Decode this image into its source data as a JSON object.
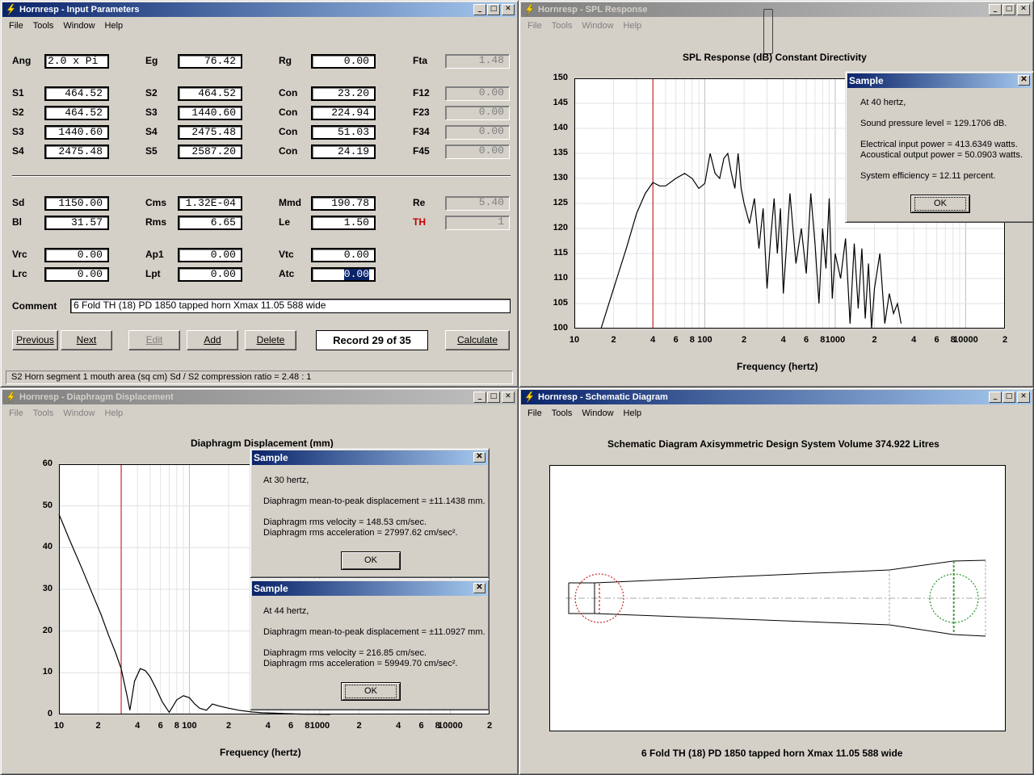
{
  "app_icon": "lightning-icon",
  "colors": {
    "active_title": "#0a246a",
    "marker": "#c00000",
    "mouth_circle": "#008000"
  },
  "input_win": {
    "title": "Hornresp - Input Parameters",
    "menu": [
      "File",
      "Tools",
      "Window",
      "Help"
    ],
    "rows": [
      [
        {
          "l": "Ang",
          "v": "2.0 x Pi"
        },
        {
          "l": "Eg",
          "v": "76.42"
        },
        {
          "l": "Rg",
          "v": "0.00"
        },
        {
          "l": "Fta",
          "v": "1.48"
        }
      ],
      [
        {
          "l": "S1",
          "v": "464.52"
        },
        {
          "l": "S2",
          "v": "464.52"
        },
        {
          "l": "Con",
          "v": "23.20"
        },
        {
          "l": "F12",
          "v": "0.00"
        }
      ],
      [
        {
          "l": "S2",
          "v": "464.52"
        },
        {
          "l": "S3",
          "v": "1440.60"
        },
        {
          "l": "Con",
          "v": "224.94"
        },
        {
          "l": "F23",
          "v": "0.00"
        }
      ],
      [
        {
          "l": "S3",
          "v": "1440.60"
        },
        {
          "l": "S4",
          "v": "2475.48"
        },
        {
          "l": "Con",
          "v": "51.03"
        },
        {
          "l": "F34",
          "v": "0.00"
        }
      ],
      [
        {
          "l": "S4",
          "v": "2475.48"
        },
        {
          "l": "S5",
          "v": "2587.20"
        },
        {
          "l": "Con",
          "v": "24.19"
        },
        {
          "l": "F45",
          "v": "0.00"
        }
      ],
      [
        {
          "l": "Sd",
          "v": "1150.00"
        },
        {
          "l": "Cms",
          "v": "1.32E-04"
        },
        {
          "l": "Mmd",
          "v": "190.78"
        },
        {
          "l": "Re",
          "v": "5.40"
        }
      ],
      [
        {
          "l": "Bl",
          "v": "31.57"
        },
        {
          "l": "Rms",
          "v": "6.65"
        },
        {
          "l": "Le",
          "v": "1.50"
        },
        {
          "l": "TH",
          "v": "1"
        }
      ],
      [
        {
          "l": "Vrc",
          "v": "0.00"
        },
        {
          "l": "Ap1",
          "v": "0.00"
        },
        {
          "l": "Vtc",
          "v": "0.00"
        }
      ],
      [
        {
          "l": "Lrc",
          "v": "0.00"
        },
        {
          "l": "Lpt",
          "v": "0.00"
        },
        {
          "l": "Atc",
          "v": "0.00"
        }
      ]
    ],
    "comment_label": "Comment",
    "comment": "6 Fold TH (18) PD 1850 tapped horn  Xmax 11.05 588 wide",
    "buttons": {
      "previous": "Previous",
      "next": "Next",
      "edit": "Edit",
      "add": "Add",
      "delete": "Delete",
      "calculate": "Calculate"
    },
    "record": "Record 29 of 35",
    "status": "S2   Horn segment 1 mouth area  (sq cm)   Sd / S2 compression ratio = 2.48 : 1"
  },
  "spl_win": {
    "title": "Hornresp - SPL Response",
    "menu": [
      "File",
      "Tools",
      "Window",
      "Help"
    ],
    "chart_title": "SPL Response (dB)   Constant Directivity",
    "xlabel": "Frequency (hertz)",
    "yticks": [
      "150",
      "145",
      "140",
      "135",
      "130",
      "125",
      "120",
      "115",
      "110",
      "105",
      "100"
    ],
    "xticks": [
      "10",
      "2",
      "4",
      "6",
      "8",
      "100",
      "2",
      "4",
      "6",
      "8",
      "1000",
      "2",
      "4",
      "6",
      "8",
      "10000",
      "2"
    ],
    "dialog": {
      "title": "Sample",
      "lines": [
        "At 40 hertz,",
        "Sound pressure level = 129.1706 dB.",
        "Electrical input power = 413.6349 watts.",
        "Acoustical output power = 50.0903 watts.",
        "System efficiency = 12.11 percent."
      ],
      "ok": "OK"
    }
  },
  "disp_win": {
    "title": "Hornresp - Diaphragm Displacement",
    "menu": [
      "File",
      "Tools",
      "Window",
      "Help"
    ],
    "chart_title": "Diaphragm Displacement (mm)",
    "xlabel": "Frequency (hertz)",
    "yticks": [
      "60",
      "50",
      "40",
      "30",
      "20",
      "10",
      "0"
    ],
    "xticks": [
      "10",
      "2",
      "4",
      "6",
      "8",
      "100",
      "2",
      "4",
      "6",
      "8",
      "1000",
      "2",
      "4",
      "6",
      "8",
      "10000",
      "2"
    ],
    "dialog1": {
      "title": "Sample",
      "lines": [
        "At 30 hertz,",
        "Diaphragm mean-to-peak displacement = ±11.1438 mm.",
        "Diaphragm rms velocity = 148.53 cm/sec.",
        "Diaphragm rms acceleration = 27997.62 cm/sec²."
      ],
      "ok": "OK"
    },
    "dialog2": {
      "title": "Sample",
      "lines": [
        "At 44 hertz,",
        "Diaphragm mean-to-peak displacement = ±11.0927 mm.",
        "Diaphragm rms velocity = 216.85 cm/sec.",
        "Diaphragm rms acceleration = 59949.70 cm/sec²."
      ],
      "ok": "OK"
    }
  },
  "schem_win": {
    "title": "Hornresp - Schematic Diagram",
    "menu": [
      "File",
      "Tools",
      "Window",
      "Help"
    ],
    "chart_title": "Schematic Diagram    Axisymmetric Design    System Volume 374.922 Litres",
    "footer": "6 Fold TH (18) PD 1850 tapped horn  Xmax 11.05 588 wide"
  },
  "chart_data": [
    {
      "type": "line",
      "title": "SPL Response (dB)   Constant Directivity",
      "xlabel": "Frequency (hertz)",
      "ylabel": "",
      "xscale": "log",
      "xlim": [
        10,
        20000
      ],
      "ylim": [
        100,
        150
      ],
      "marker_x": 40,
      "series": [
        {
          "x": [
            16,
            20,
            25,
            30,
            35,
            40,
            45,
            50,
            60,
            70,
            80,
            90,
            100,
            110,
            120,
            130,
            140,
            150,
            160,
            170,
            180,
            190,
            200,
            220,
            240,
            260,
            280,
            300,
            320,
            340,
            360,
            380,
            400,
            450,
            500,
            550,
            600,
            650,
            700,
            750,
            800,
            850,
            900,
            950,
            1000,
            1100,
            1200,
            1300,
            1400,
            1500,
            1600,
            1700,
            1800,
            1900,
            2000,
            2200,
            2400,
            2600,
            2800,
            3000,
            3200
          ],
          "y": [
            100,
            108,
            116,
            123,
            127,
            129.2,
            128.5,
            128.5,
            130,
            131,
            130,
            128,
            129,
            135,
            131,
            130,
            134,
            135,
            131,
            128,
            135,
            128,
            125,
            121,
            126,
            116,
            124,
            108,
            118,
            126,
            115,
            124,
            107,
            127,
            113,
            120,
            111,
            127,
            117,
            105,
            120,
            112,
            126,
            106,
            115,
            110,
            118,
            101,
            117,
            104,
            116,
            102,
            113,
            100,
            108,
            115,
            101,
            107,
            103,
            105,
            101
          ]
        }
      ]
    },
    {
      "type": "line",
      "title": "Diaphragm Displacement (mm)",
      "xlabel": "Frequency (hertz)",
      "ylabel": "",
      "xscale": "log",
      "xlim": [
        10,
        20000
      ],
      "ylim": [
        0,
        60
      ],
      "marker_x": 30,
      "series": [
        {
          "x": [
            10,
            12,
            15,
            18,
            21,
            24,
            27,
            30,
            33,
            35,
            38,
            42,
            46,
            50,
            56,
            62,
            70,
            80,
            90,
            100,
            110,
            120,
            135,
            150,
            170,
            200,
            240,
            300,
            360,
            450,
            550,
            700,
            900,
            1200
          ],
          "y": [
            48,
            42,
            35,
            29,
            24,
            19,
            15,
            11,
            5,
            1,
            8,
            11,
            10.5,
            9,
            6,
            3,
            0.5,
            3.5,
            4.5,
            4,
            2.5,
            1.5,
            1,
            2.5,
            2,
            1.5,
            1,
            0.6,
            0.4,
            0.3,
            0.2,
            0.1,
            0.05,
            0.02
          ]
        }
      ]
    }
  ]
}
